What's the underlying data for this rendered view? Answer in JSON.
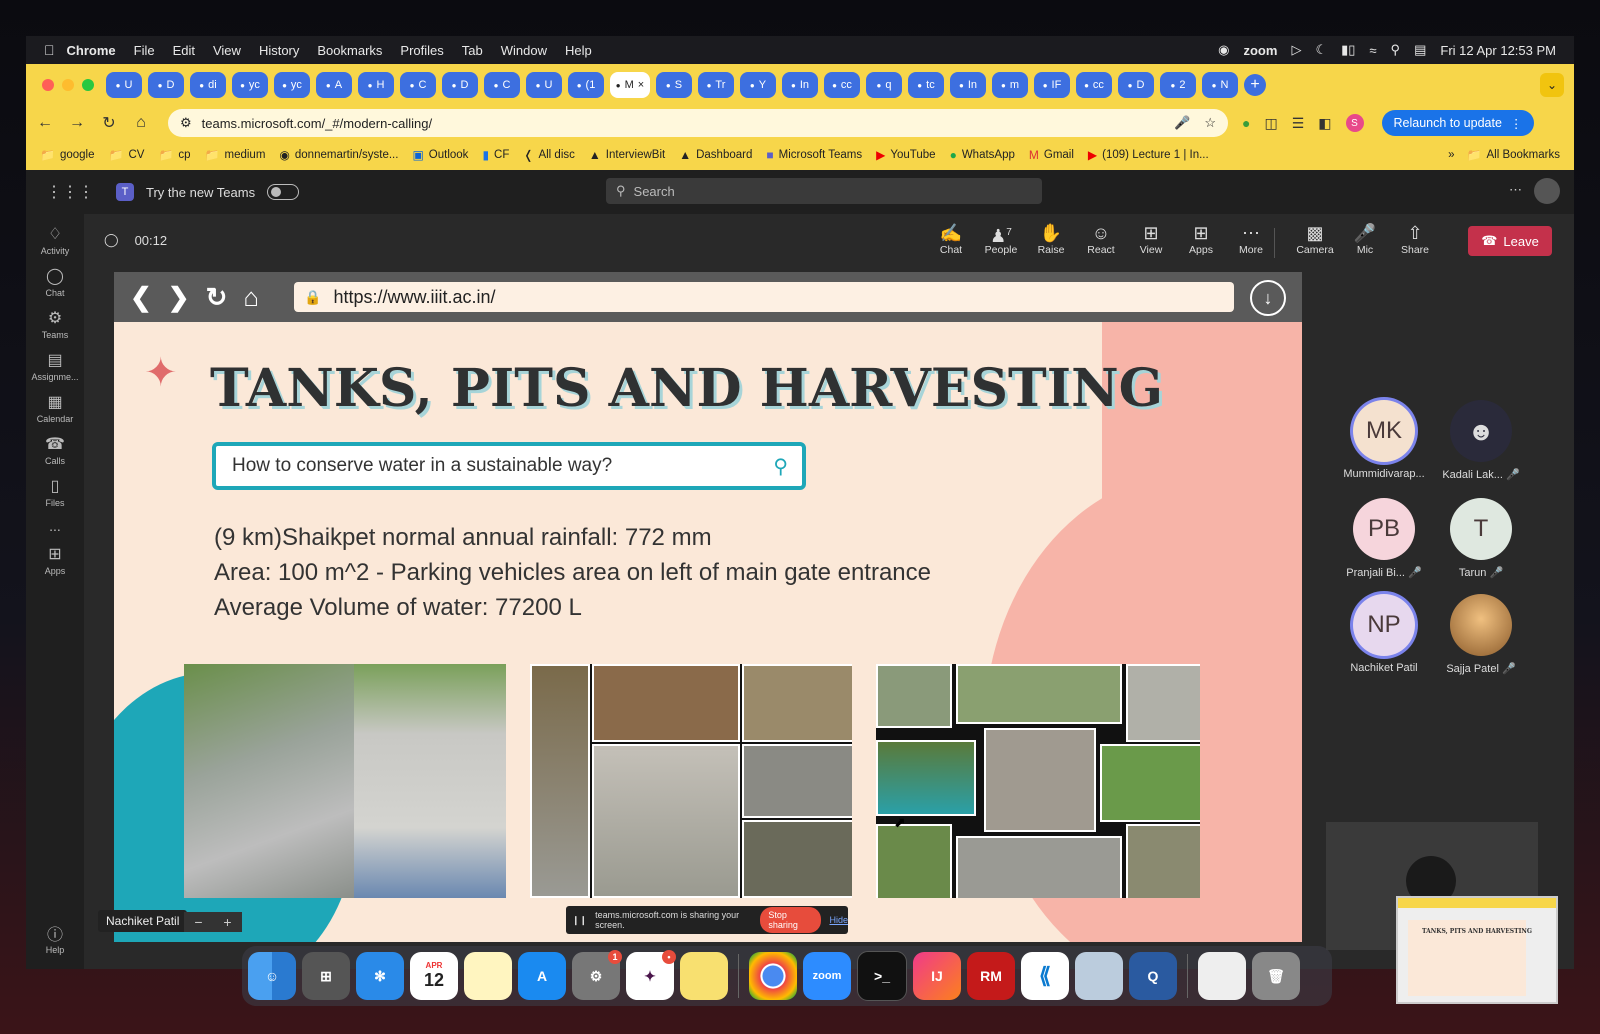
{
  "menubar": {
    "app": "Chrome",
    "items": [
      "File",
      "Edit",
      "View",
      "History",
      "Bookmarks",
      "Profiles",
      "Tab",
      "Window",
      "Help"
    ],
    "zoom_label": "zoom",
    "datetime": "Fri 12 Apr  12:53 PM"
  },
  "tabs": [
    {
      "label": "U"
    },
    {
      "label": "D"
    },
    {
      "label": "di"
    },
    {
      "label": "yc"
    },
    {
      "label": "yc"
    },
    {
      "label": "A"
    },
    {
      "label": "H"
    },
    {
      "label": "C"
    },
    {
      "label": "D"
    },
    {
      "label": "C"
    },
    {
      "label": "U"
    },
    {
      "label": "(1"
    },
    {
      "label": "M",
      "active": true
    },
    {
      "label": "S"
    },
    {
      "label": "Tr"
    },
    {
      "label": "Y"
    },
    {
      "label": "In"
    },
    {
      "label": "cc"
    },
    {
      "label": "q"
    },
    {
      "label": "tc"
    },
    {
      "label": "In"
    },
    {
      "label": "m"
    },
    {
      "label": "IF"
    },
    {
      "label": "cc"
    },
    {
      "label": "D"
    },
    {
      "label": "2"
    },
    {
      "label": "N"
    }
  ],
  "address": {
    "url": "teams.microsoft.com/_#/modern-calling/",
    "relaunch": "Relaunch to update"
  },
  "bookmarks": {
    "items": [
      "google",
      "CV",
      "cp",
      "medium",
      "donnemartin/syste...",
      "Outlook",
      "CF",
      "All disc",
      "InterviewBit",
      "Dashboard",
      "Microsoft Teams",
      "YouTube",
      "WhatsApp",
      "Gmail",
      "(109) Lecture 1 | In..."
    ],
    "more": "»",
    "all": "All Bookmarks"
  },
  "teams": {
    "try_new": "Try the new Teams",
    "search_placeholder": "Search",
    "rail": [
      "Activity",
      "Chat",
      "Teams",
      "Assignme...",
      "Calendar",
      "Calls",
      "Files",
      "...",
      "Apps"
    ],
    "help": "Help"
  },
  "meeting": {
    "timer": "00:12",
    "controls": [
      {
        "label": "Chat",
        "icon": "chat-icon"
      },
      {
        "label": "People",
        "icon": "people-icon",
        "count": "7"
      },
      {
        "label": "Raise",
        "icon": "hand-icon"
      },
      {
        "label": "React",
        "icon": "smile-icon"
      },
      {
        "label": "View",
        "icon": "grid-icon"
      },
      {
        "label": "Apps",
        "icon": "plus-square-icon"
      },
      {
        "label": "More",
        "icon": "more-icon"
      },
      {
        "label": "Camera",
        "icon": "camera-off-icon"
      },
      {
        "label": "Mic",
        "icon": "mic-off-icon"
      },
      {
        "label": "Share",
        "icon": "share-icon"
      }
    ],
    "leave": "Leave"
  },
  "slide": {
    "url": "https://www.iiit.ac.in/",
    "title": "TANKS, PITS AND HARVESTING",
    "query": "How to conserve water in a sustainable way?",
    "lines": [
      "(9 km)Shaikpet normal annual rainfall: 772 mm",
      "Area: 100 m^2 - Parking vehicles area on left of main gate entrance",
      "Average Volume of water: 77200 L"
    ]
  },
  "sharing": {
    "msg": "teams.microsoft.com is sharing your screen.",
    "stop": "Stop sharing",
    "hide": "Hide"
  },
  "presenter": "Nachiket Patil",
  "participants": [
    {
      "initials": "MK",
      "name": "Mummidivarap...",
      "color": "#f4e1cf"
    },
    {
      "initials": "",
      "name": "Kadali Lak...",
      "color": "#2a2a3a"
    },
    {
      "initials": "PB",
      "name": "Pranjali Bi...",
      "color": "#f6d5dc"
    },
    {
      "initials": "T",
      "name": "Tarun",
      "color": "#dfe8e0"
    },
    {
      "initials": "NP",
      "name": "Nachiket Patil",
      "color": "#e7d8ee"
    },
    {
      "initials": "",
      "name": "Sajja Patel",
      "color": "#b67c3e"
    }
  ],
  "dock": {
    "calendar_month": "APR",
    "calendar_day": "12",
    "zoom": "zoom",
    "ij": "IJ",
    "rm": "RM"
  }
}
